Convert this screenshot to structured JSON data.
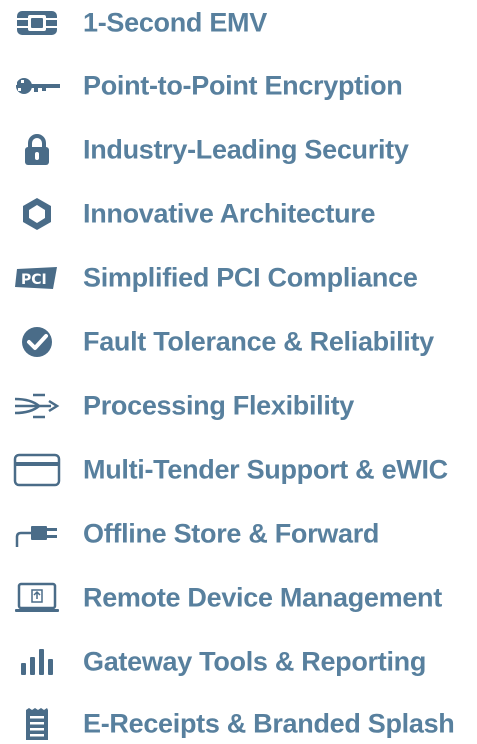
{
  "colors": {
    "icon": "#4a6c88",
    "label": "#58809e",
    "background": "#ffffff"
  },
  "features": [
    {
      "label": "1-Second EMV",
      "icon": "chip-card-icon"
    },
    {
      "label": "Point-to-Point Encryption",
      "icon": "key-icon"
    },
    {
      "label": "Industry-Leading Security",
      "icon": "padlock-icon"
    },
    {
      "label": "Innovative Architecture",
      "icon": "hexagon-icon"
    },
    {
      "label": "Simplified PCI Compliance",
      "icon": "pci-badge-icon"
    },
    {
      "label": "Fault Tolerance & Reliability",
      "icon": "check-badge-icon"
    },
    {
      "label": "Processing Flexibility",
      "icon": "branching-arrows-icon"
    },
    {
      "label": "Multi-Tender Support & eWIC",
      "icon": "card-icon"
    },
    {
      "label": "Offline Store & Forward",
      "icon": "plug-icon"
    },
    {
      "label": "Remote Device Management",
      "icon": "laptop-upload-icon"
    },
    {
      "label": "Gateway Tools & Reporting",
      "icon": "bar-chart-icon"
    },
    {
      "label": "E-Receipts & Branded Splash",
      "icon": "receipt-icon"
    }
  ]
}
